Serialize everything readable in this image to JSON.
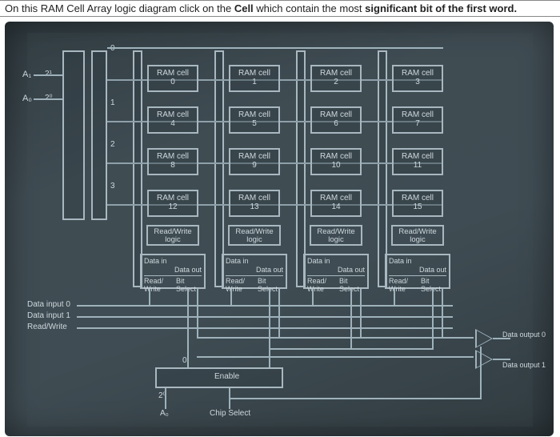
{
  "header": {
    "prefix": "On this RAM Cell Array logic diagram click on the ",
    "bold1": "Cell",
    "mid": " which contain the most ",
    "bold2": "significant bit of the first word."
  },
  "address_inputs": {
    "a1": "A₁",
    "a0": "A₀",
    "w1": "2¹",
    "w0": "2⁰"
  },
  "row_index": {
    "r0": "0",
    "r1": "1",
    "r2": "2",
    "r3": "3"
  },
  "cells": {
    "label": "RAM cell",
    "nums": [
      "0",
      "1",
      "2",
      "3",
      "4",
      "5",
      "6",
      "7",
      "8",
      "9",
      "10",
      "11",
      "12",
      "13",
      "14",
      "15"
    ]
  },
  "rw_logic": "Read/Write logic",
  "iobox": {
    "data_in": "Data in",
    "data_out": "Data out",
    "read_write": "Read/ Write",
    "bit_select": "Bit Select"
  },
  "left_labels": {
    "di0": "Data input 0",
    "di1": "Data input 1",
    "rw": "Read/Write"
  },
  "bottom": {
    "zero": "0",
    "two0": "2⁰",
    "a0": "A₀",
    "enable": "Enable",
    "chip_select": "Chip Select"
  },
  "outputs": {
    "do0": "Data output 0",
    "do1": "Data output 1"
  }
}
